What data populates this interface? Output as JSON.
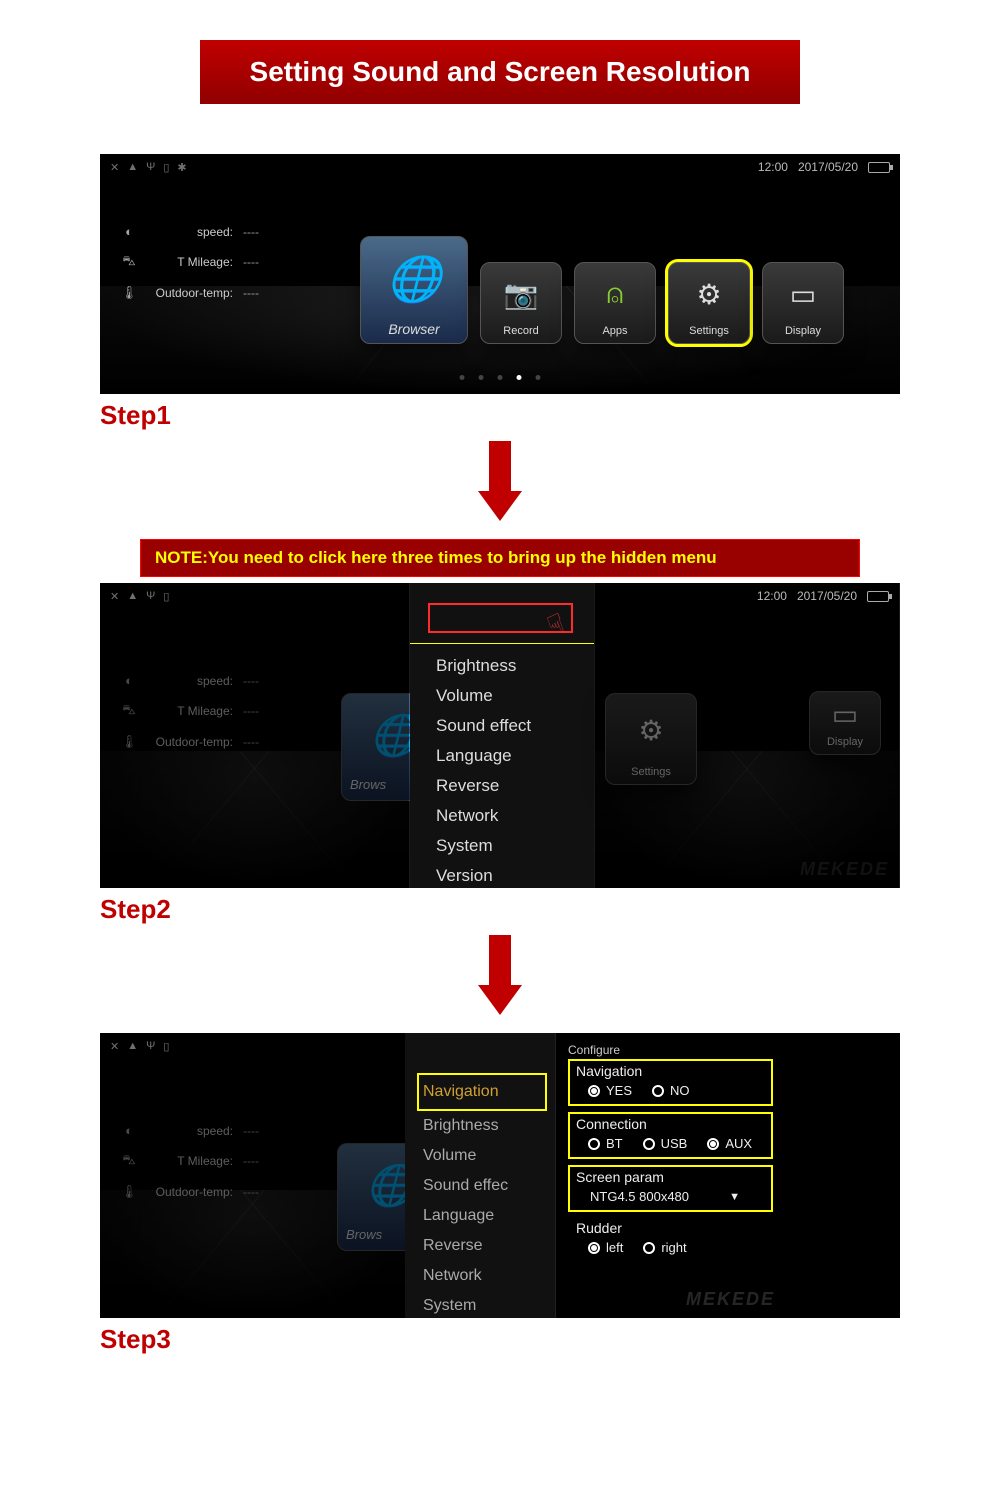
{
  "title": "Setting Sound and Screen Resolution",
  "steps": {
    "s1": "Step1",
    "s2": "Step2",
    "s3": "Step3"
  },
  "note": "NOTE:You need to click here three times to bring up the hidden menu",
  "statusbar": {
    "time": "12:00",
    "date": "2017/05/20"
  },
  "sidebar": {
    "speed_label": "speed:",
    "speed_value": "----",
    "mileage_label": "T Mileage:",
    "mileage_value": "----",
    "temp_label": "Outdoor-temp:",
    "temp_value": "----"
  },
  "tiles": {
    "browser": "Browser",
    "record": "Record",
    "apps": "Apps",
    "settings": "Settings",
    "display": "Display"
  },
  "menu": {
    "brightness": "Brightness",
    "volume": "Volume",
    "sound_effect": "Sound effect",
    "language": "Language",
    "reverse": "Reverse",
    "network": "Network",
    "system": "System",
    "version": "Version"
  },
  "menu3": {
    "navigation": "Navigation",
    "brightness": "Brightness",
    "volume": "Volume",
    "sound_effect": "Sound effec",
    "language": "Language",
    "reverse": "Reverse",
    "network": "Network",
    "system": "System"
  },
  "config": {
    "configure": "Configure",
    "navigation": "Navigation",
    "yes": "YES",
    "no": "NO",
    "connection": "Connection",
    "bt": "BT",
    "usb": "USB",
    "aux": "AUX",
    "screen_param": "Screen param",
    "screen_value": "NTG4.5 800x480",
    "rudder": "Rudder",
    "left": "left",
    "right": "right"
  },
  "watermark": "MEKEDE"
}
